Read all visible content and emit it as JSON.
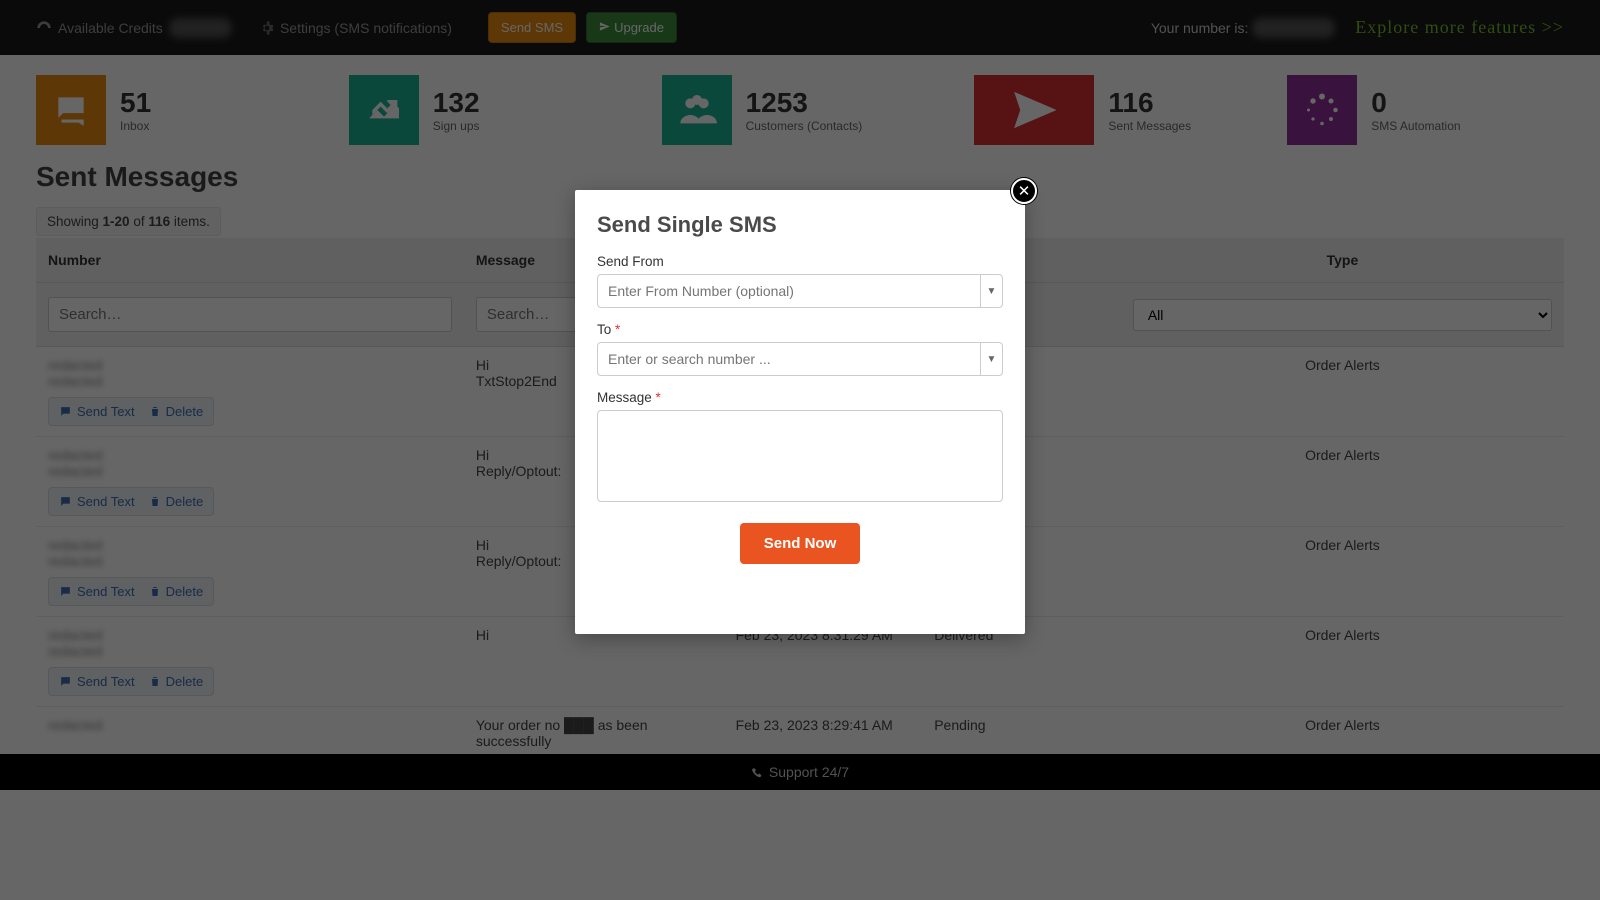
{
  "topbar": {
    "credits_label": "Available Credits",
    "credits_value": "0000",
    "settings_label": "Settings (SMS notifications)",
    "send_sms_btn": "Send SMS",
    "upgrade_btn": "Upgrade",
    "your_number_label": "Your number is:",
    "your_number_value": "+1 0000",
    "explore_label": "Explore more features >>"
  },
  "cards": {
    "inbox": {
      "value": "51",
      "label": "Inbox",
      "color": "#e88b0d"
    },
    "signups": {
      "value": "132",
      "label": "Sign ups",
      "color": "#1ab394"
    },
    "customers": {
      "value": "1253",
      "label": "Customers (Contacts)",
      "color": "#1ab394"
    },
    "sent": {
      "value": "116",
      "label": "Sent Messages",
      "color": "#d93030"
    },
    "automation": {
      "value": "0",
      "label": "SMS Automation",
      "color": "#8e2f9a"
    }
  },
  "page": {
    "title": "Sent Messages",
    "showing_pre": "Showing ",
    "showing_range": "1-20",
    "showing_mid": " of ",
    "showing_total": "116",
    "showing_post": " items."
  },
  "table": {
    "headers": {
      "number": "Number",
      "message": "Message",
      "type": "Type"
    },
    "search_placeholder": "Search…",
    "filter_all": "All",
    "rows": [
      {
        "number": "redacted",
        "name": "redacted",
        "message": "Hi\nTxtStop2End",
        "date": "",
        "status": "",
        "type": "Order Alerts"
      },
      {
        "number": "redacted",
        "name": "redacted",
        "message": "Hi\nReply/Optout:",
        "date": "",
        "status": "",
        "type": "Order Alerts"
      },
      {
        "number": "redacted",
        "name": "redacted",
        "message": "Hi\nReply/Optout:",
        "date": "",
        "status": "",
        "type": "Order Alerts"
      },
      {
        "number": "redacted",
        "name": "redacted",
        "message": "Hi",
        "date": "Feb 23, 2023 8:31:29 AM",
        "status": "Delivered",
        "type": "Order Alerts"
      },
      {
        "number": "redacted",
        "name": "",
        "message": "Your order no ███ as been successfully",
        "date": "Feb 23, 2023 8:29:41 AM",
        "status": "Pending",
        "type": "Order Alerts"
      }
    ],
    "actions": {
      "send_text": "Send Text",
      "delete": "Delete"
    }
  },
  "footer": {
    "support": "Support 24/7"
  },
  "modal": {
    "title": "Send Single SMS",
    "from_label": "Send From",
    "from_placeholder": "Enter From Number (optional)",
    "to_label": "To",
    "to_placeholder": "Enter or search number ...",
    "message_label": "Message",
    "send_now": "Send Now"
  }
}
